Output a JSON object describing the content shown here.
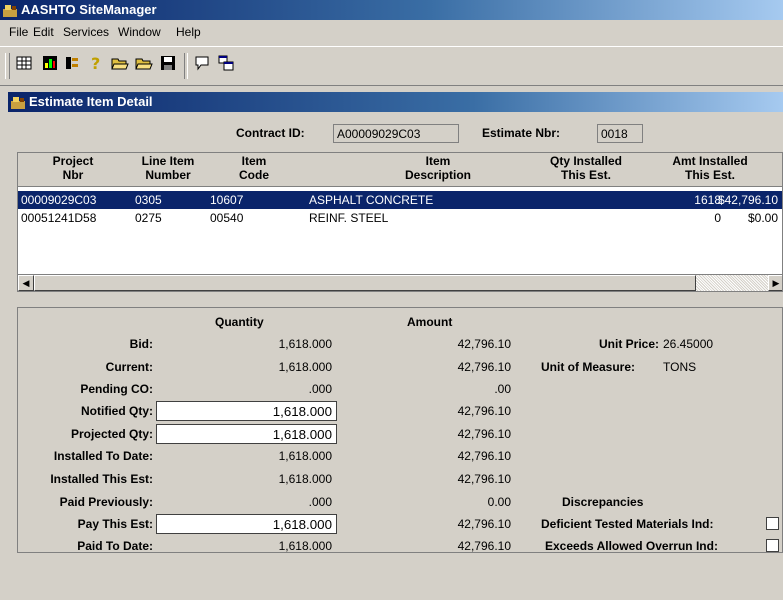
{
  "app": {
    "title": "AASHTO SiteManager"
  },
  "menu": [
    "File",
    "Edit",
    "Services",
    "Window",
    "Help"
  ],
  "toolbar_icons": [
    "grid-icon",
    "chart-icon",
    "tree-icon",
    "help-icon",
    "open-folder-icon",
    "open-folder-alt-icon",
    "save-icon",
    "speech-bubble-icon",
    "windows-icon"
  ],
  "window": {
    "title": "Estimate Item Detail"
  },
  "header": {
    "contract_label": "Contract ID:",
    "contract_value": "A00009029C03",
    "estimate_label": "Estimate Nbr:",
    "estimate_value": "0018"
  },
  "grid": {
    "columns": [
      {
        "line1": "Project",
        "line2": "Nbr"
      },
      {
        "line1": "Line Item",
        "line2": "Number"
      },
      {
        "line1": "Item",
        "line2": "Code"
      },
      {
        "line1": "Item",
        "line2": "Description"
      },
      {
        "line1": "Qty Installed",
        "line2": "This Est."
      },
      {
        "line1": "Amt Installed",
        "line2": "This Est."
      }
    ],
    "rows": [
      {
        "project": "00009029C03",
        "line": "0305",
        "code": "10607",
        "desc": "ASPHALT CONCRETE",
        "qty": "1618",
        "amt": "$42,796.10"
      },
      {
        "project": "00051241D58",
        "line": "0275",
        "code": "00540",
        "desc": "REINF. STEEL",
        "qty": "0",
        "amt": "$0.00"
      }
    ]
  },
  "details": {
    "col_quantity": "Quantity",
    "col_amount": "Amount",
    "rows": [
      {
        "label": "Bid:",
        "qty": "1,618.000",
        "amt": "42,796.10"
      },
      {
        "label": "Current:",
        "qty": "1,618.000",
        "amt": "42,796.10"
      },
      {
        "label": "Pending CO:",
        "qty": ".000",
        "amt": ".00"
      },
      {
        "label": "Notified Qty:",
        "qty": "1,618.000",
        "amt": "42,796.10"
      },
      {
        "label": "Projected Qty:",
        "qty": "1,618.000",
        "amt": "42,796.10"
      },
      {
        "label": "Installed To Date:",
        "qty": "1,618.000",
        "amt": "42,796.10"
      },
      {
        "label": "Installed This Est:",
        "qty": "1,618.000",
        "amt": "42,796.10"
      },
      {
        "label": "Paid Previously:",
        "qty": ".000",
        "amt": "0.00"
      },
      {
        "label": "Pay This Est:",
        "qty": "1,618.000",
        "amt": "42,796.10"
      },
      {
        "label": "Paid To Date:",
        "qty": "1,618.000",
        "amt": "42,796.10"
      }
    ],
    "unit_price_label": "Unit Price:",
    "unit_price_value": "26.45000",
    "uom_label": "Unit of Measure:",
    "uom_value": "TONS",
    "discrepancies_label": "Discrepancies",
    "deficient_label": "Deficient Tested Materials Ind:",
    "deficient_checked": false,
    "overrun_label": "Exceeds Allowed Overrun Ind:",
    "overrun_checked": false
  }
}
